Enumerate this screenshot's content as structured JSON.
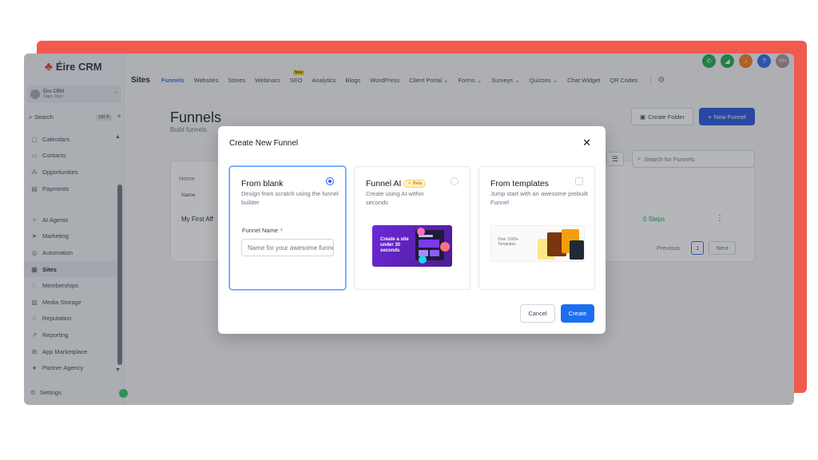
{
  "brand": {
    "name": "Éire CRM",
    "accent": "#f05a4f"
  },
  "account": {
    "name": "Eire CRM",
    "sub": "Sligo, Sligo"
  },
  "sidebar": {
    "search_label": "Search",
    "shortcut": "ctrl K",
    "items": [
      {
        "label": "Calendars",
        "icon": "calendar-icon"
      },
      {
        "label": "Contacts",
        "icon": "contacts-icon"
      },
      {
        "label": "Opportunities",
        "icon": "opportunities-icon"
      },
      {
        "label": "Payments",
        "icon": "payments-icon"
      },
      {
        "label": "AI Agents",
        "icon": "ai-agents-icon"
      },
      {
        "label": "Marketing",
        "icon": "marketing-icon"
      },
      {
        "label": "Automation",
        "icon": "automation-icon"
      },
      {
        "label": "Sites",
        "icon": "sites-icon",
        "active": true
      },
      {
        "label": "Memberships",
        "icon": "memberships-icon"
      },
      {
        "label": "Media Storage",
        "icon": "media-storage-icon"
      },
      {
        "label": "Reputation",
        "icon": "reputation-icon"
      },
      {
        "label": "Reporting",
        "icon": "reporting-icon"
      },
      {
        "label": "App Marketplace",
        "icon": "app-marketplace-icon"
      },
      {
        "label": "Partner Agency",
        "icon": "partner-agency-icon"
      }
    ],
    "settings_label": "Settings"
  },
  "topnav": {
    "section": "Sites",
    "tabs": [
      "Funnels",
      "Websites",
      "Stores",
      "Webinars",
      "SEO",
      "Analytics",
      "Blogs",
      "WordPress",
      "Client Portal",
      "Forms",
      "Surveys",
      "Quizzes",
      "Chat Widget",
      "QR Codes"
    ],
    "active_tab": "Funnels",
    "new_badge": "New",
    "user_initials": "RH"
  },
  "page": {
    "title": "Funnels",
    "subtitle": "Build funnels",
    "create_folder": "Create Folder",
    "new_funnel": "New Funnel",
    "search_placeholder": "Search for Funnels",
    "breadcrumb": "Home",
    "col_name": "Name",
    "row_name": "My First Aff",
    "row_steps": "0 Steps",
    "pager": {
      "previous": "Previous",
      "current": "1",
      "next": "Next"
    }
  },
  "modal": {
    "title": "Create New Funnel",
    "options": [
      {
        "title": "From blank",
        "desc": "Design from scratch using the funnel builder",
        "selected": true
      },
      {
        "title": "Funnel AI",
        "badge": "Beta",
        "desc": "Create using AI within seconds",
        "thumb_text": "Create a site under 30 seconds"
      },
      {
        "title": "From templates",
        "desc": "Jump start with an awesome prebuilt Funnel",
        "thumb_text": "Over 1000+ Templates"
      }
    ],
    "funnel_name_label": "Funnel Name",
    "funnel_name_placeholder": "Name for your awesome funnel",
    "cancel": "Cancel",
    "create": "Create"
  }
}
